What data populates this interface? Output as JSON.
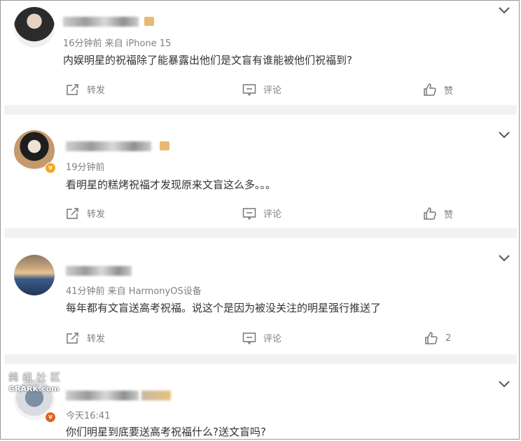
{
  "comments": [
    {
      "meta": "16分钟前  来自 iPhone 15",
      "text": "内娱明星的祝福除了能暴露出他们是文盲有谁能被他们祝福到?",
      "repost": "转发",
      "comment": "评论",
      "like": "赞"
    },
    {
      "meta": "19分钟前",
      "text": "看明星的糕烤祝福才发现原来文盲这么多。。。",
      "repost": "转发",
      "comment": "评论",
      "like": "赞",
      "badge": "v"
    },
    {
      "meta": "41分钟前  来自 HarmonyOS设备",
      "text": "每年都有文盲送高考祝福。说这个是因为被没关注的明星强行推送了",
      "repost": "转发",
      "comment": "评论",
      "like": "2"
    },
    {
      "meta": "今天16:41",
      "text": "你们明星到底要送高考祝福什么?送文盲吗?",
      "badge": "v"
    }
  ],
  "watermark": {
    "line1": "鸽组社区",
    "line2": "GRARK.com"
  },
  "colors": {
    "badge_gold": "#f5a623",
    "badge_orange": "#e0661f",
    "rank_icon": "#e9b873",
    "separator": "#f2f2f2"
  },
  "icons": [
    "chevron-down-icon",
    "repost-icon",
    "comment-icon",
    "like-icon"
  ]
}
